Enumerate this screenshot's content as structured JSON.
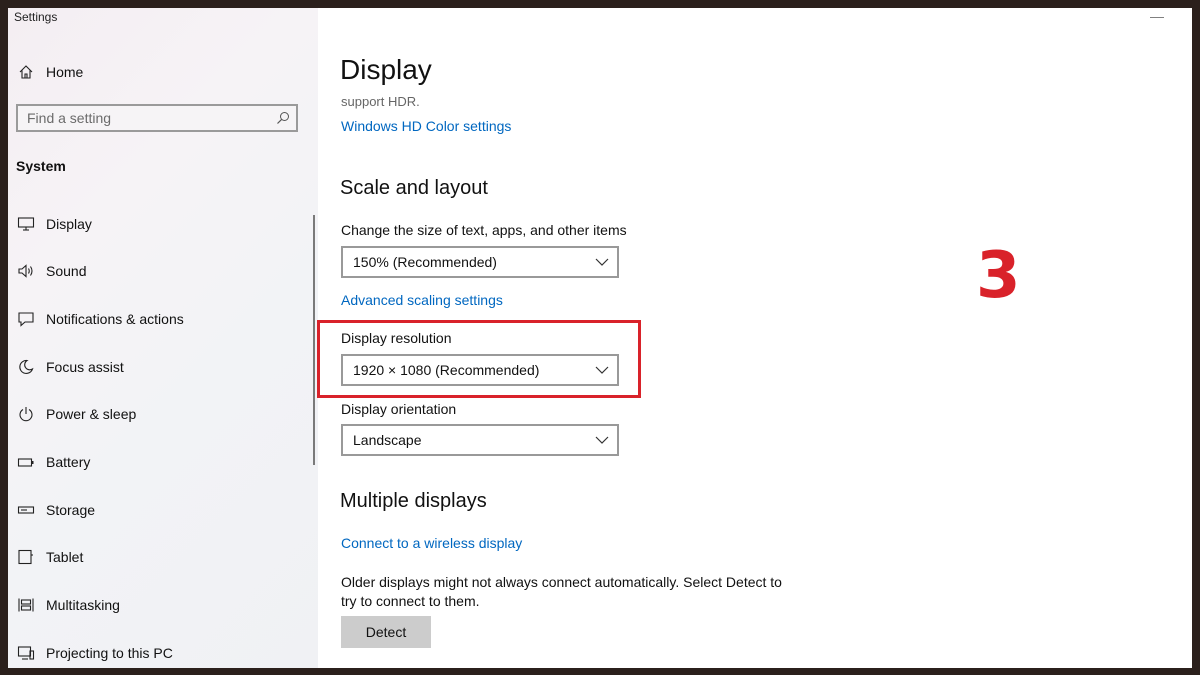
{
  "window": {
    "title": "Settings"
  },
  "sidebar": {
    "home_label": "Home",
    "search_placeholder": "Find a setting",
    "section": "System",
    "items": [
      {
        "label": "Display",
        "icon": "monitor-icon"
      },
      {
        "label": "Sound",
        "icon": "speaker-icon"
      },
      {
        "label": "Notifications & actions",
        "icon": "message-icon"
      },
      {
        "label": "Focus assist",
        "icon": "moon-icon"
      },
      {
        "label": "Power & sleep",
        "icon": "power-icon"
      },
      {
        "label": "Battery",
        "icon": "battery-icon"
      },
      {
        "label": "Storage",
        "icon": "storage-icon"
      },
      {
        "label": "Tablet",
        "icon": "tablet-icon"
      },
      {
        "label": "Multitasking",
        "icon": "multitasking-icon"
      },
      {
        "label": "Projecting to this PC",
        "icon": "projecting-icon"
      }
    ]
  },
  "main": {
    "title": "Display",
    "hdr_text": "support HDR.",
    "hdr_link": "Windows HD Color settings",
    "scale_heading": "Scale and layout",
    "scale_label": "Change the size of text, apps, and other items",
    "scale_value": "150% (Recommended)",
    "advanced_link": "Advanced scaling settings",
    "resolution_label": "Display resolution",
    "resolution_value": "1920 × 1080 (Recommended)",
    "orientation_label": "Display orientation",
    "orientation_value": "Landscape",
    "multi_heading": "Multiple displays",
    "wireless_link": "Connect to a wireless display",
    "detect_desc": "Older displays might not always connect automatically. Select Detect to try to connect to them.",
    "detect_button": "Detect"
  },
  "annotation": {
    "step": "3",
    "color": "#d9222a"
  },
  "colors": {
    "link": "#0067c0",
    "accent_annotation": "#d9222a"
  }
}
